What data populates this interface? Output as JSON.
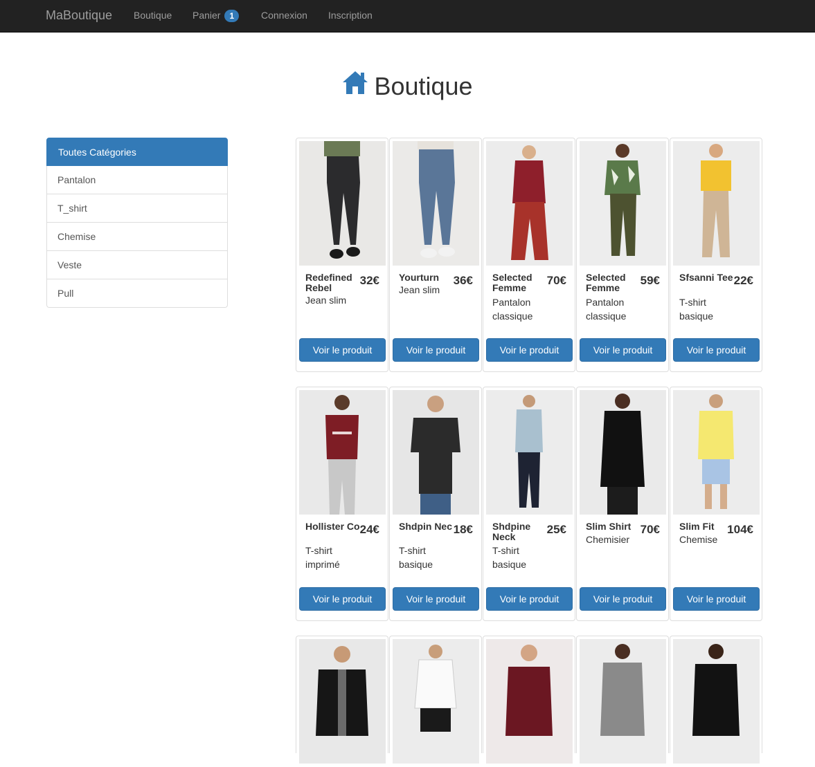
{
  "navbar": {
    "brand": "MaBoutique",
    "links": [
      {
        "label": "Boutique"
      },
      {
        "label": "Panier",
        "badge": "1"
      },
      {
        "label": "Connexion"
      },
      {
        "label": "Inscription"
      }
    ]
  },
  "page": {
    "title": "Boutique",
    "title_icon": "home-icon"
  },
  "sidebar": {
    "header": "Toutes Catégories",
    "items": [
      "Pantalon",
      "T_shirt",
      "Chemise",
      "Veste",
      "Pull"
    ]
  },
  "products": [
    {
      "name": "Redefined Rebel",
      "price": "32€",
      "category": "Jean slim",
      "button": "Voir le produit"
    },
    {
      "name": "Yourturn",
      "price": "36€",
      "category": "Jean slim",
      "button": "Voir le produit"
    },
    {
      "name": "Selected Femme",
      "price": "70€",
      "category": "Pantalon classique",
      "button": "Voir le produit"
    },
    {
      "name": "Selected Femme",
      "price": "59€",
      "category": "Pantalon classique",
      "button": "Voir le produit"
    },
    {
      "name": "Sfsanni Tee",
      "price": "22€",
      "category": "T-shirt basique",
      "button": "Voir le produit"
    },
    {
      "name": "Hollister Co",
      "price": "24€",
      "category": "T-shirt imprimé",
      "button": "Voir le produit"
    },
    {
      "name": "Shdpin Nec",
      "price": "18€",
      "category": "T-shirt basique",
      "button": "Voir le produit"
    },
    {
      "name": "Shdpine Neck",
      "price": "25€",
      "category": "T-shirt basique",
      "button": "Voir le produit"
    },
    {
      "name": "Slim Shirt",
      "price": "70€",
      "category": "Chemisier",
      "button": "Voir le produit"
    },
    {
      "name": "Slim Fit",
      "price": "104€",
      "category": "Chemise",
      "button": "Voir le produit"
    }
  ],
  "colors": {
    "primary": "#337ab7",
    "navbar": "#222222"
  }
}
